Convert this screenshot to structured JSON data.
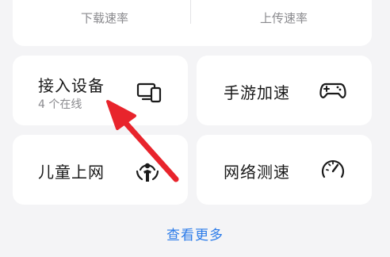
{
  "rates": {
    "download_label": "下载速率",
    "upload_label": "上传速率"
  },
  "tiles": [
    {
      "title": "接入设备",
      "subtitle": "4 个在线",
      "icon": "devices-icon"
    },
    {
      "title": "手游加速",
      "icon": "gamepad-icon"
    },
    {
      "title": "儿童上网",
      "icon": "child-icon"
    },
    {
      "title": "网络测速",
      "icon": "speedometer-icon"
    }
  ],
  "footer": {
    "more_label": "查看更多"
  },
  "colors": {
    "accent": "#2b7be9",
    "annotation_arrow": "#e8242c",
    "icon": "#1a1a1a"
  }
}
